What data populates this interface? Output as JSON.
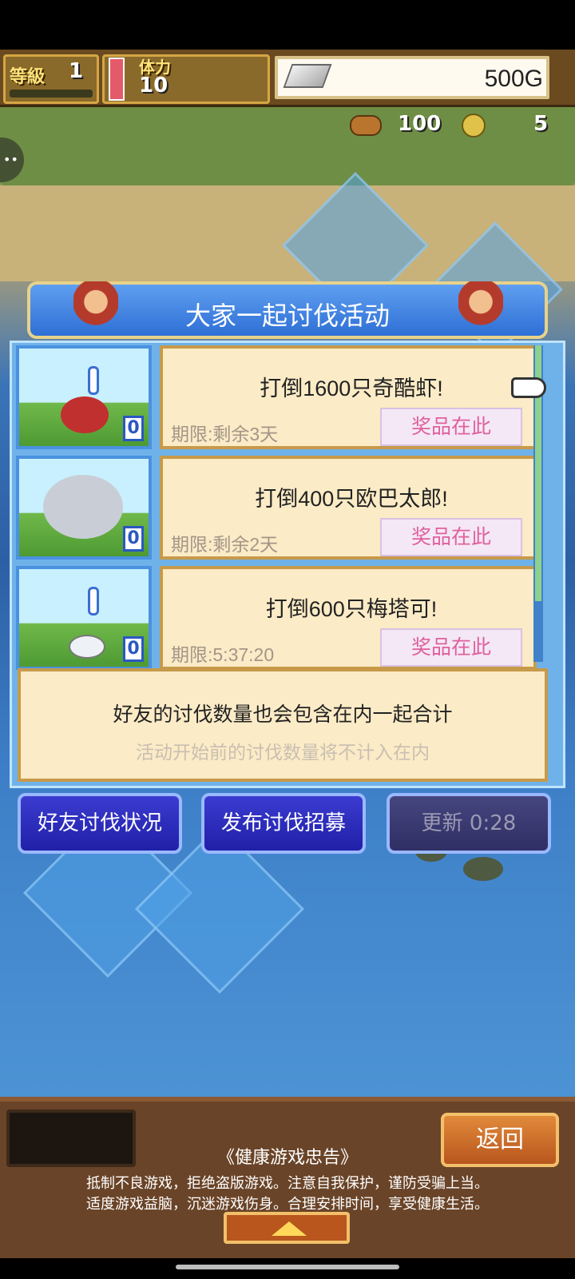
{
  "hud": {
    "level_label": "等級",
    "level_value": "1",
    "stamina_label": "体力",
    "stamina_value": "10",
    "gold": "500G",
    "food": "100",
    "medals": "5"
  },
  "dialog": {
    "title": "大家一起讨伐活动",
    "quests": [
      {
        "title": "打倒1600只奇酷虾!",
        "deadline": "期限:剩余3天",
        "prize_button": "奖品在此",
        "count": "0",
        "monster": "red-scorpion",
        "monster_color": "#c0302e"
      },
      {
        "title": "打倒400只欧巴太郎!",
        "deadline": "期限:剩余2天",
        "prize_button": "奖品在此",
        "count": "0",
        "monster": "robot-spider",
        "monster_color": "#c9ced6"
      },
      {
        "title": "打倒600只梅塔可!",
        "deadline": "期限:5:37:20",
        "prize_button": "奖品在此",
        "count": "0",
        "monster": "white-slime",
        "monster_color": "#eef1f5"
      }
    ],
    "info_line1": "好友的讨伐数量也会包含在内一起合计",
    "info_line2": "活动开始前的讨伐数量将不计入在内"
  },
  "buttons": {
    "friend_status": "好友讨伐状况",
    "post_recruit": "发布讨伐招募",
    "refresh": "更新 0:28"
  },
  "bottom": {
    "back": "返回",
    "advice_title": "《健康游戏忠告》",
    "advice_line1": "抵制不良游戏，拒绝盗版游戏。注意自我保护，谨防受骗上当。",
    "advice_line2": "适度游戏益脑，沉迷游戏伤身。合理安排时间，享受健康生活。"
  },
  "colors": {
    "panel_blue": "#6fb2ea",
    "card_cream": "#fbebc6",
    "prize_pink": "#e0609e",
    "button_blue": "#2020a8",
    "back_orange": "#b8561e"
  }
}
